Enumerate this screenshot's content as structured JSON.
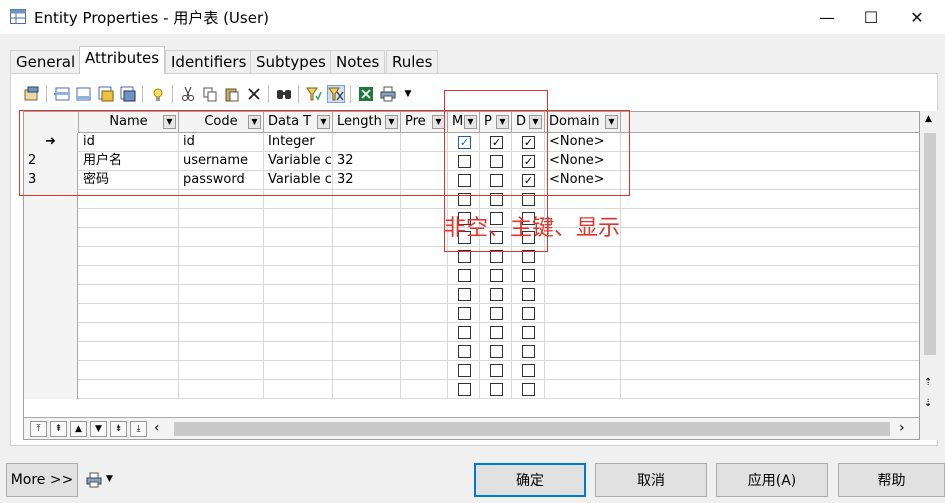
{
  "window": {
    "title": "Entity Properties - 用户表 (User)",
    "minimize_glyph": "—",
    "maximize_glyph": "☐",
    "close_glyph": "✕"
  },
  "tabs": [
    "General",
    "Attributes",
    "Identifiers",
    "Subtypes",
    "Notes",
    "Rules"
  ],
  "active_tab": "Attributes",
  "grid": {
    "columns": [
      "Name",
      "Code",
      "Data T",
      "Length",
      "Pre",
      "M",
      "P",
      "D",
      "Domain"
    ],
    "rows": [
      {
        "marker": "➜",
        "name": "id",
        "code": "id",
        "type": "Integer",
        "length": "",
        "prec": "",
        "m": true,
        "p": true,
        "d": true,
        "domain": "<None>"
      },
      {
        "marker": "2",
        "name": "用户名",
        "code": "username",
        "type": "Variable c",
        "length": "32",
        "prec": "",
        "m": false,
        "p": false,
        "d": true,
        "domain": "<None>"
      },
      {
        "marker": "3",
        "name": "密码",
        "code": "password",
        "type": "Variable c",
        "length": "32",
        "prec": "",
        "m": false,
        "p": false,
        "d": true,
        "domain": "<None>"
      }
    ],
    "empty_rows": 11
  },
  "annotation": "非空、主键、显示",
  "buttons": {
    "more": "More >>",
    "ok": "确定",
    "cancel": "取消",
    "apply": "应用(A)",
    "help": "帮助"
  },
  "colors": {
    "annotation": "#e0342d",
    "primary_border": "#0078d7"
  },
  "toolbar_icons": [
    "properties-icon",
    "insert-row-icon",
    "add-row-icon",
    "add-attributes-icon",
    "reuse-attributes-icon",
    "new-domain-icon",
    "cut-icon",
    "copy-icon",
    "paste-icon",
    "delete-icon",
    "find-icon",
    "filter-icon",
    "filter-active-icon",
    "export-excel-icon",
    "print-icon",
    "dropdown-arrow-icon"
  ]
}
